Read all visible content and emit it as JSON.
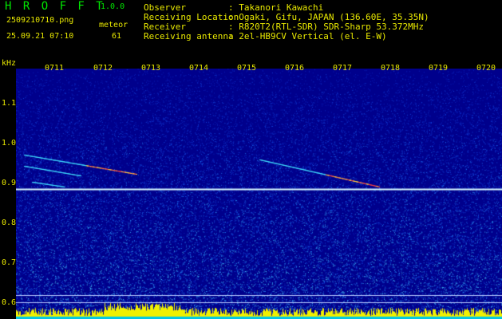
{
  "header": {
    "app_title": "H R O F F T",
    "app_version": "1.0.0",
    "file_name": "2509210710.png",
    "timestamp": "25.09.21 07:10",
    "meteor_label": "meteor",
    "meteor_count": "61",
    "info": [
      {
        "key": "Observer",
        "value": ": Takanori Kawachi"
      },
      {
        "key": "Receiving Location",
        "value": ": Ogaki, Gifu, JAPAN (136.60E, 35.35N)"
      },
      {
        "key": "Receiver",
        "value": ": R820T2(RTL-SDR) SDR-Sharp 53.372MHz"
      },
      {
        "key": "Receiving antenna",
        "value": ": 2el-HB9CV Vertical (el. E-W)"
      }
    ]
  },
  "plot": {
    "unit_label": "kHz",
    "time_ticks": [
      "0711",
      "0712",
      "0713",
      "0714",
      "0715",
      "0716",
      "0717",
      "0718",
      "0719",
      "0720"
    ],
    "freq_ticks": [
      "1.1",
      "1.0",
      "0.9",
      "0.8",
      "0.7",
      "0.6"
    ],
    "colors": {
      "background": "#00008c",
      "noise": [
        "#0a1fb8",
        "#1040d8",
        "#1a6ae8",
        "#2fa0f0",
        "#50d0f8"
      ],
      "signal_bar": "#f0f000",
      "signal_bar_low": "#00c8e8",
      "carrier": "#d8f8ff",
      "reference_line": "#b8c8ff"
    }
  }
}
